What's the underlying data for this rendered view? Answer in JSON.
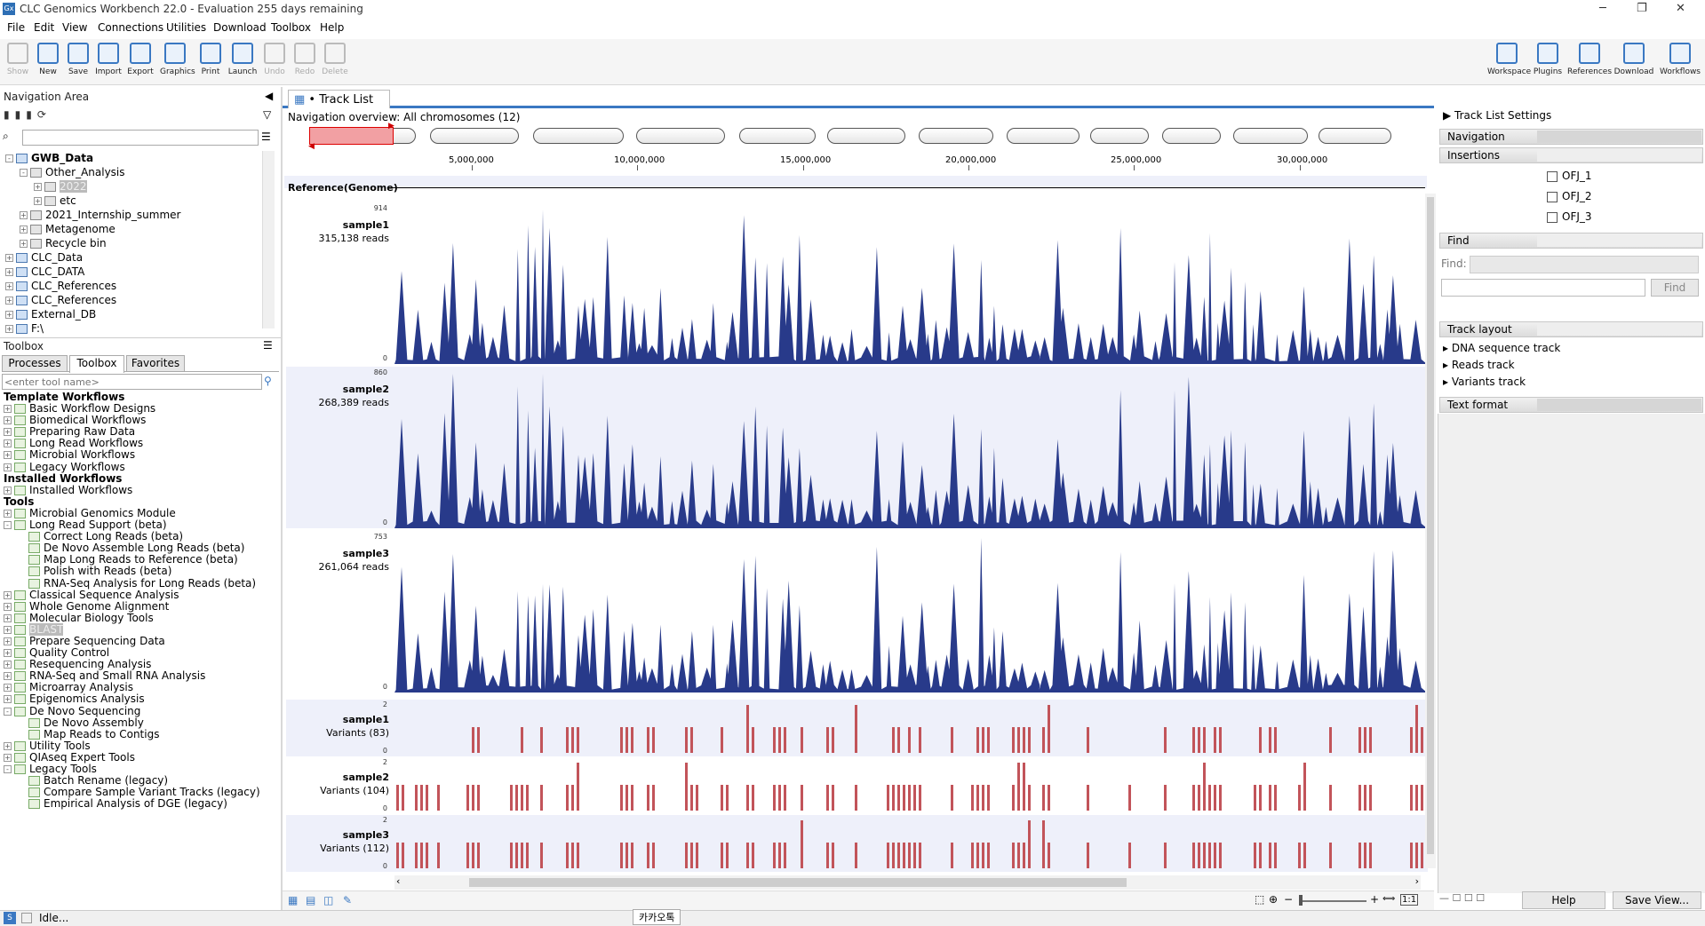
{
  "window": {
    "title": "CLC Genomics Workbench 22.0 - Evaluation 255 days remaining",
    "app_icon": "Gx"
  },
  "menu": [
    "File",
    "Edit",
    "View",
    "Connections",
    "Utilities",
    "Download",
    "Toolbox",
    "Help"
  ],
  "toolbar": {
    "left": [
      {
        "label": "Show",
        "icon": "show-icon",
        "enabled": false
      },
      {
        "label": "New",
        "icon": "new-icon",
        "enabled": true
      },
      {
        "label": "Save",
        "icon": "save-icon",
        "enabled": true
      },
      {
        "label": "Import",
        "icon": "import-icon",
        "enabled": true
      },
      {
        "label": "Export",
        "icon": "export-icon",
        "enabled": true
      },
      {
        "label": "Graphics",
        "icon": "graphics-icon",
        "enabled": true
      },
      {
        "label": "Print",
        "icon": "print-icon",
        "enabled": true
      },
      {
        "label": "Launch",
        "icon": "launch-icon",
        "enabled": true
      },
      {
        "label": "Undo",
        "icon": "undo-icon",
        "enabled": false
      },
      {
        "label": "Redo",
        "icon": "redo-icon",
        "enabled": false
      },
      {
        "label": "Delete",
        "icon": "delete-icon",
        "enabled": false
      }
    ],
    "right": [
      {
        "label": "Workspace"
      },
      {
        "label": "Plugins"
      },
      {
        "label": "References"
      },
      {
        "label": "Download"
      },
      {
        "label": "Workflows"
      }
    ]
  },
  "navigation": {
    "title": "Navigation Area",
    "tree": [
      {
        "label": "GWB_Data",
        "level": 0,
        "exp": "-",
        "bold": true,
        "db": true
      },
      {
        "label": "Other_Analysis",
        "level": 1,
        "exp": "-"
      },
      {
        "label": "2022",
        "level": 2,
        "exp": "+",
        "grey": true
      },
      {
        "label": "etc",
        "level": 2,
        "exp": "+"
      },
      {
        "label": "2021_Internship_summer",
        "level": 1,
        "exp": "+"
      },
      {
        "label": "Metagenome",
        "level": 1,
        "exp": "+"
      },
      {
        "label": "Recycle bin",
        "level": 1,
        "exp": "+"
      },
      {
        "label": "CLC_Data",
        "level": 0,
        "exp": "+",
        "db": true
      },
      {
        "label": "CLC_DATA",
        "level": 0,
        "exp": "+",
        "db": true
      },
      {
        "label": "CLC_References",
        "level": 0,
        "exp": "+",
        "db": true
      },
      {
        "label": "CLC_References",
        "level": 0,
        "exp": "+",
        "db": true
      },
      {
        "label": "External_DB",
        "level": 0,
        "exp": "+",
        "db": true
      },
      {
        "label": "F:\\",
        "level": 0,
        "exp": "+",
        "db": true
      }
    ]
  },
  "toolbox": {
    "title": "Toolbox",
    "tabs": [
      "Processes",
      "Toolbox",
      "Favorites"
    ],
    "active_tab": "Toolbox",
    "search_placeholder": "<enter tool name>",
    "items": [
      {
        "label": "Template Workflows",
        "type": "section"
      },
      {
        "label": "Basic Workflow Designs",
        "level": 0,
        "exp": "+"
      },
      {
        "label": "Biomedical Workflows",
        "level": 0,
        "exp": "+"
      },
      {
        "label": "Preparing Raw Data",
        "level": 0,
        "exp": "+"
      },
      {
        "label": "Long Read Workflows",
        "level": 0,
        "exp": "+"
      },
      {
        "label": "Microbial Workflows",
        "level": 0,
        "exp": "+"
      },
      {
        "label": "Legacy Workflows",
        "level": 0,
        "exp": "+"
      },
      {
        "label": "Installed Workflows",
        "type": "section"
      },
      {
        "label": "Installed Workflows",
        "level": 0,
        "exp": "+"
      },
      {
        "label": "Tools",
        "type": "section"
      },
      {
        "label": "Microbial Genomics Module",
        "level": 0,
        "exp": "+"
      },
      {
        "label": "Long Read Support (beta)",
        "level": 0,
        "exp": "-"
      },
      {
        "label": "Correct Long Reads (beta)",
        "level": 1
      },
      {
        "label": "De Novo Assemble Long Reads (beta)",
        "level": 1
      },
      {
        "label": "Map Long Reads to Reference (beta)",
        "level": 1
      },
      {
        "label": "Polish with Reads (beta)",
        "level": 1
      },
      {
        "label": "RNA-Seq Analysis for Long Reads (beta)",
        "level": 1
      },
      {
        "label": "Classical Sequence Analysis",
        "level": 0,
        "exp": "+"
      },
      {
        "label": "Whole Genome Alignment",
        "level": 0,
        "exp": "+"
      },
      {
        "label": "Molecular Biology Tools",
        "level": 0,
        "exp": "+"
      },
      {
        "label": "BLAST",
        "level": 0,
        "exp": "+",
        "grey": true
      },
      {
        "label": "Prepare Sequencing Data",
        "level": 0,
        "exp": "+"
      },
      {
        "label": "Quality Control",
        "level": 0,
        "exp": "+"
      },
      {
        "label": "Resequencing Analysis",
        "level": 0,
        "exp": "+"
      },
      {
        "label": "RNA-Seq and Small RNA Analysis",
        "level": 0,
        "exp": "+"
      },
      {
        "label": "Microarray Analysis",
        "level": 0,
        "exp": "+"
      },
      {
        "label": "Epigenomics Analysis",
        "level": 0,
        "exp": "+"
      },
      {
        "label": "De Novo Sequencing",
        "level": 0,
        "exp": "-"
      },
      {
        "label": "De Novo Assembly",
        "level": 1
      },
      {
        "label": "Map Reads to Contigs",
        "level": 1
      },
      {
        "label": "Utility Tools",
        "level": 0,
        "exp": "+"
      },
      {
        "label": "QIAseq Expert Tools",
        "level": 0,
        "exp": "+"
      },
      {
        "label": "Legacy Tools",
        "level": 0,
        "exp": "-"
      },
      {
        "label": "Batch Rename (legacy)",
        "level": 1
      },
      {
        "label": "Compare Sample Variant Tracks (legacy)",
        "level": 1
      },
      {
        "label": "Empirical Analysis of DGE (legacy)",
        "level": 1
      }
    ]
  },
  "editor": {
    "tab_label": "Track List",
    "nav_overview": "Navigation overview: All chromosomes (12)",
    "chromosome_count": 12,
    "ticks": [
      "5,000,000",
      "10,000,000",
      "15,000,000",
      "20,000,000",
      "25,000,000",
      "30,000,000"
    ],
    "reference_label": "Reference(Genome)",
    "coverage_tracks": [
      {
        "name": "sample1",
        "reads": "315,138 reads",
        "ymax": "914",
        "ymin": "0"
      },
      {
        "name": "sample2",
        "reads": "268,389 reads",
        "ymax": "860",
        "ymin": "0"
      },
      {
        "name": "sample3",
        "reads": "261,064 reads",
        "ymax": "753",
        "ymin": "0"
      }
    ],
    "variant_tracks": [
      {
        "name": "sample1",
        "count": "Variants (83)",
        "ymax": "2",
        "ymin": "0"
      },
      {
        "name": "sample2",
        "count": "Variants (104)",
        "ymax": "2",
        "ymin": "0"
      },
      {
        "name": "sample3",
        "count": "Variants (112)",
        "ymax": "2",
        "ymin": "0"
      }
    ],
    "colors": {
      "coverage": "#283a8a",
      "variant": "#c2545a",
      "track_bg": "#eef0fa",
      "accent": "#3a78c2"
    }
  },
  "settings": {
    "title": "Track List Settings",
    "navigation": "Navigation",
    "insertions": "Insertions",
    "insertion_items": [
      "OFJ_1",
      "OFJ_2",
      "OFJ_3"
    ],
    "find": "Find",
    "find_label": "Find:",
    "find_button": "Find",
    "track_layout": "Track layout",
    "layout_items": [
      "DNA sequence track",
      "Reads track",
      "Variants track"
    ],
    "text_format": "Text format",
    "help": "Help",
    "save_view": "Save View..."
  },
  "status": {
    "text": "Idle...",
    "ime": "카카오톡"
  }
}
